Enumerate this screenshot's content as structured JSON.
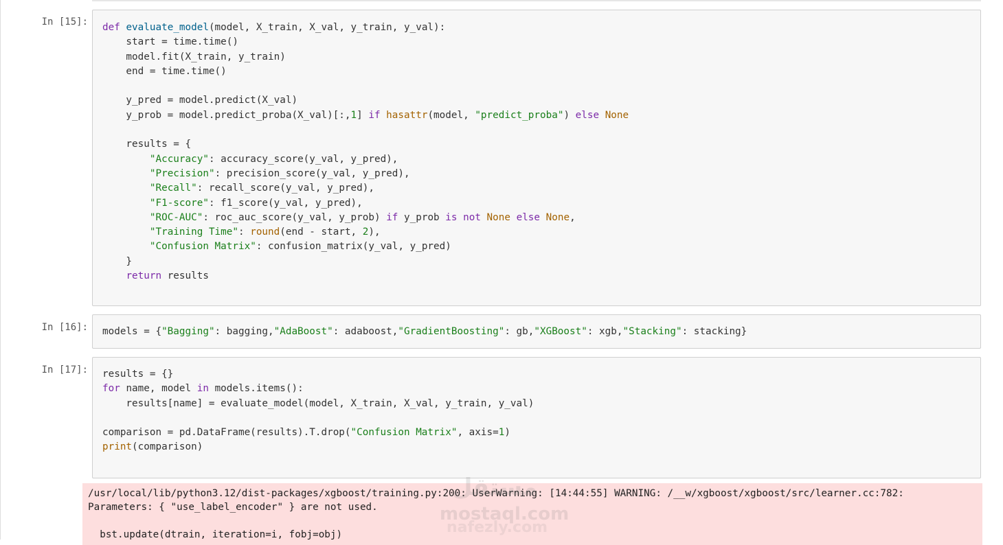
{
  "cells": [
    {
      "prompt": "In [15]:",
      "lines": [
        [
          [
            "kw",
            "def "
          ],
          [
            "fn",
            "evaluate_model"
          ],
          [
            "",
            "(model, X_train, X_val, y_train, y_val):"
          ]
        ],
        [
          [
            "",
            "    start = time.time()"
          ]
        ],
        [
          [
            "",
            "    model.fit(X_train, y_train)"
          ]
        ],
        [
          [
            "",
            "    end = time.time()"
          ]
        ],
        [
          [
            "",
            ""
          ]
        ],
        [
          [
            "",
            "    y_pred = model.predict(X_val)"
          ]
        ],
        [
          [
            "",
            "    y_prob = model.predict_proba(X_val)[:,"
          ],
          [
            "num",
            "1"
          ],
          [
            "",
            "] "
          ],
          [
            "kw",
            "if "
          ],
          [
            "bi",
            "hasattr"
          ],
          [
            "",
            "(model, "
          ],
          [
            "str",
            "\"predict_proba\""
          ],
          [
            "",
            ") "
          ],
          [
            "kw",
            "else "
          ],
          [
            "bi",
            "None"
          ]
        ],
        [
          [
            "",
            ""
          ]
        ],
        [
          [
            "",
            "    results = {"
          ]
        ],
        [
          [
            "",
            "        "
          ],
          [
            "str",
            "\"Accuracy\""
          ],
          [
            "",
            ": accuracy_score(y_val, y_pred),"
          ]
        ],
        [
          [
            "",
            "        "
          ],
          [
            "str",
            "\"Precision\""
          ],
          [
            "",
            ": precision_score(y_val, y_pred),"
          ]
        ],
        [
          [
            "",
            "        "
          ],
          [
            "str",
            "\"Recall\""
          ],
          [
            "",
            ": recall_score(y_val, y_pred),"
          ]
        ],
        [
          [
            "",
            "        "
          ],
          [
            "str",
            "\"F1-score\""
          ],
          [
            "",
            ": f1_score(y_val, y_pred),"
          ]
        ],
        [
          [
            "",
            "        "
          ],
          [
            "str",
            "\"ROC-AUC\""
          ],
          [
            "",
            ": roc_auc_score(y_val, y_prob) "
          ],
          [
            "kw",
            "if "
          ],
          [
            "",
            "y_prob "
          ],
          [
            "kw",
            "is not "
          ],
          [
            "bi",
            "None "
          ],
          [
            "kw",
            "else "
          ],
          [
            "bi",
            "None"
          ],
          [
            "",
            ","
          ]
        ],
        [
          [
            "",
            "        "
          ],
          [
            "str",
            "\"Training Time\""
          ],
          [
            "",
            ": "
          ],
          [
            "bi",
            "round"
          ],
          [
            "",
            "(end - start, "
          ],
          [
            "num",
            "2"
          ],
          [
            "",
            "),"
          ]
        ],
        [
          [
            "",
            "        "
          ],
          [
            "str",
            "\"Confusion Matrix\""
          ],
          [
            "",
            ": confusion_matrix(y_val, y_pred)"
          ]
        ],
        [
          [
            "",
            "    }"
          ]
        ],
        [
          [
            "",
            "    "
          ],
          [
            "kw",
            "return "
          ],
          [
            "",
            "results"
          ]
        ]
      ]
    },
    {
      "prompt": "In [16]:",
      "lines": [
        [
          [
            "",
            "models = {"
          ],
          [
            "str",
            "\"Bagging\""
          ],
          [
            "",
            ": bagging,"
          ],
          [
            "str",
            "\"AdaBoost\""
          ],
          [
            "",
            ": adaboost,"
          ],
          [
            "str",
            "\"GradientBoosting\""
          ],
          [
            "",
            ": gb,"
          ],
          [
            "str",
            "\"XGBoost\""
          ],
          [
            "",
            ": xgb,"
          ],
          [
            "str",
            "\"Stacking\""
          ],
          [
            "",
            ": stacking}"
          ]
        ]
      ]
    },
    {
      "prompt": "In [17]:",
      "lines": [
        [
          [
            "",
            "results = {}"
          ]
        ],
        [
          [
            "kw",
            "for "
          ],
          [
            "",
            "name, model "
          ],
          [
            "kw",
            "in "
          ],
          [
            "",
            "models.items():"
          ]
        ],
        [
          [
            "",
            "    results[name] = evaluate_model(model, X_train, X_val, y_train, y_val)"
          ]
        ],
        [
          [
            "",
            ""
          ]
        ],
        [
          [
            "",
            "comparison = pd.DataFrame(results).T.drop("
          ],
          [
            "str",
            "\"Confusion Matrix\""
          ],
          [
            "",
            ", axis="
          ],
          [
            "num",
            "1"
          ],
          [
            "",
            ")"
          ]
        ],
        [
          [
            "bi",
            "print"
          ],
          [
            "",
            "(comparison)"
          ]
        ]
      ]
    }
  ],
  "stderr": {
    "text": "/usr/local/lib/python3.12/dist-packages/xgboost/training.py:200: UserWarning: [14:44:55] WARNING: /__w/xgboost/xgboost/src/learner.cc:782:\nParameters: { \"use_label_encoder\" } are not used.\n\n  bst.update(dtrain, iteration=i, fobj=obj)"
  },
  "watermark": {
    "arabic": "مستقل",
    "latin": "mostaql.com",
    "latin2": "nafezly.com"
  },
  "colors": {
    "keyword": "#7c2aa8",
    "def_name": "#00618c",
    "string": "#1a7f1a",
    "builtin": "#a36200",
    "stderr_bg": "#fddede",
    "cell_bg": "#f7f7f7"
  }
}
